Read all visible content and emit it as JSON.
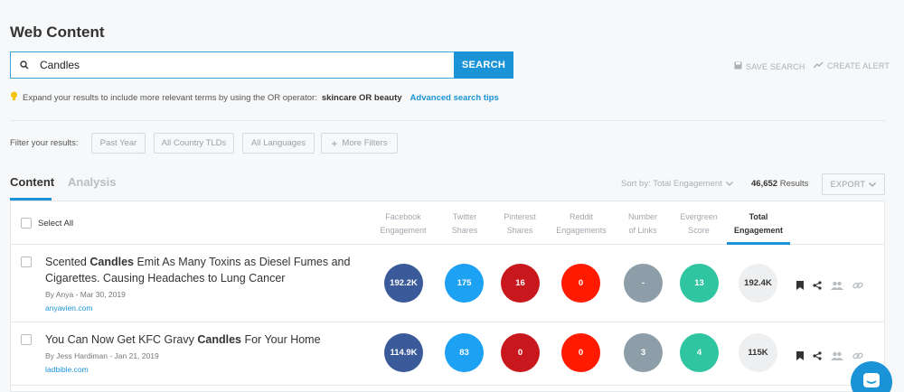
{
  "page": {
    "title": "Web Content"
  },
  "search": {
    "value": "Candles",
    "button_label": "SEARCH",
    "save_label": "SAVE SEARCH",
    "alert_label": "CREATE ALERT"
  },
  "tip": {
    "text": "Expand your results to include more relevant terms by using the OR operator:",
    "example": "skincare OR beauty",
    "link": "Advanced search tips"
  },
  "filters": {
    "label": "Filter your results:",
    "items": [
      "Past Year",
      "All Country TLDs",
      "All Languages"
    ],
    "more_label": "More Filters"
  },
  "tabs": [
    {
      "label": "Content"
    },
    {
      "label": "Analysis"
    }
  ],
  "results_bar": {
    "sort_label": "Sort by: Total Engagement",
    "count": "46,652",
    "count_suffix": "Results",
    "export_label": "EXPORT"
  },
  "table": {
    "select_all": "Select All",
    "columns": [
      {
        "line1": "Facebook",
        "line2": "Engagement"
      },
      {
        "line1": "Twitter",
        "line2": "Shares"
      },
      {
        "line1": "Pinterest",
        "line2": "Shares"
      },
      {
        "line1": "Reddit",
        "line2": "Engagements"
      },
      {
        "line1": "Number",
        "line2": "of Links"
      },
      {
        "line1": "Evergreen",
        "line2": "Score"
      },
      {
        "line1": "Total",
        "line2": "Engagement"
      }
    ],
    "rows": [
      {
        "title_pre": "Scented ",
        "title_bold": "Candles",
        "title_post": " Emit As Many Toxins as Diesel Fumes and Cigarettes. Causing Headaches to Lung Cancer",
        "meta": "By Anya - Mar 30, 2019",
        "domain": "anyavien.com",
        "metrics": [
          "192.2K",
          "175",
          "16",
          "0",
          "-",
          "13",
          "192.4K"
        ]
      },
      {
        "title_pre": "You Can Now Get KFC Gravy ",
        "title_bold": "Candles",
        "title_post": " For Your Home",
        "meta": "By Jess Hardiman - Jan 21, 2019",
        "domain": "ladbible.com",
        "metrics": [
          "114.9K",
          "83",
          "0",
          "0",
          "3",
          "4",
          "115K"
        ]
      }
    ]
  },
  "colors": {
    "accent": "#1a94d7",
    "facebook": "#3b5a9a",
    "twitter": "#1da1f2",
    "pinterest": "#c8181e",
    "reddit": "#ff1a00",
    "links": "#8e9ea8",
    "evergreen": "#2ec5a0",
    "total": "#eeeff0"
  }
}
